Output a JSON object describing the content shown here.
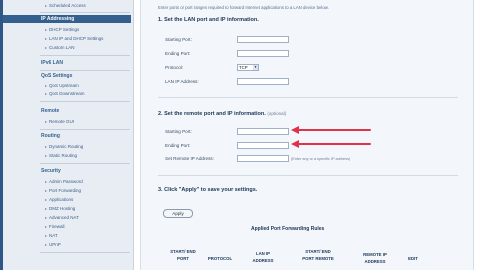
{
  "sidebar": {
    "top_item": "Scheduled Access",
    "sections": [
      {
        "title": "IP Addressing",
        "items": [
          "DHCP Settings",
          "LAN IP and DHCP Settings",
          "Custom LAN"
        ]
      },
      {
        "title": "IPv6 LAN",
        "items": []
      },
      {
        "title": "QoS Settings",
        "items": [
          "QoS Upstream",
          "QoS Downstream"
        ]
      },
      {
        "title": "Remote",
        "items": [
          "Remote GUI"
        ]
      },
      {
        "title": "Routing",
        "items": [
          "Dynamic Routing",
          "Static Routing"
        ]
      },
      {
        "title": "Security",
        "items": [
          "Admin Password",
          "Port Forwarding",
          "Applications",
          "DMZ Hosting",
          "Advanced NAT",
          "Firewall",
          "NAT",
          "UPnP"
        ]
      }
    ]
  },
  "intro": "Enter ports or port ranges required to forward Internet applications to a LAN device below.",
  "section1": {
    "title": "1. Set the LAN port and IP information.",
    "starting_port_label": "Starting Port:",
    "ending_port_label": "Ending Port:",
    "protocol_label": "Protocol:",
    "protocol_value": "TCP",
    "lan_ip_label": "LAN IP Address:"
  },
  "section2": {
    "title": "2. Set the remote port and IP information.",
    "optional": "(optional)",
    "starting_port_label": "Starting Port:",
    "ending_port_label": "Ending Port:",
    "remote_ip_label": "Set Remote IP Address:",
    "remote_ip_hint": "(Enter any or a specific IP address)"
  },
  "section3": {
    "title": "3. Click \"Apply\" to save your settings.",
    "apply": "Apply"
  },
  "table": {
    "title": "Applied Port Forwarding Rules",
    "headers": [
      "START/ END PORT",
      "PROTOCOL",
      "LAN IP ADDRESS",
      "START/ END PORT REMOTE",
      "REMOTE IP ADDRESS",
      "EDIT"
    ]
  },
  "colors": {
    "accent_arrow": "#e0324a",
    "sidebar_header": "#34608f"
  }
}
